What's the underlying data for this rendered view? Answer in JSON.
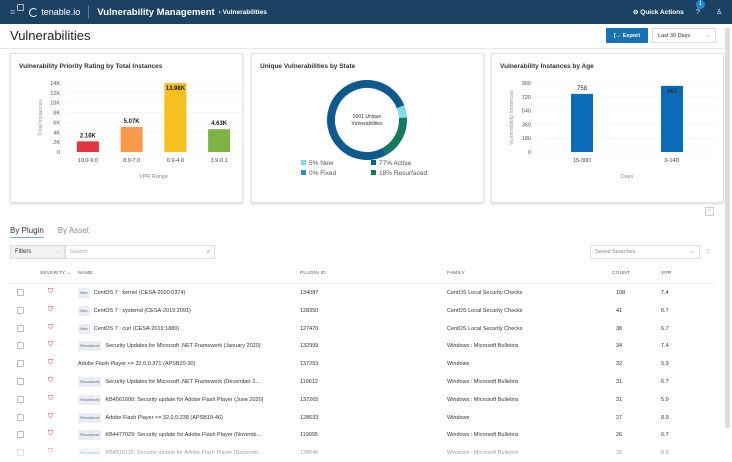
{
  "header": {
    "app_logo": "tenable.io",
    "app": "Vulnerability Management",
    "breadcrumb": "› Vulnerabilities",
    "quick_actions": "Quick Actions",
    "notification_count": "1"
  },
  "page": {
    "title": "Vulnerabilities",
    "export_label": "Export",
    "date_range": "Last 30 Days"
  },
  "colors": {
    "header": "#1b4262",
    "accent": "#1771b8"
  },
  "chart_data": [
    {
      "type": "bar",
      "title": "Vulnerability Priority Rating by Total Instances",
      "xlabel": "VPR Range",
      "ylabel": "Total Instances",
      "ylim": [
        0,
        14000
      ],
      "yticks": [
        "0",
        "2K",
        "4K",
        "6K",
        "8K",
        "10K",
        "12K",
        "14K"
      ],
      "categories": [
        "10.0-9.0",
        "8.9-7.0",
        "6.9-4.0",
        "3.9-0.1"
      ],
      "values": [
        2160,
        5070,
        13980,
        4630
      ],
      "labels": [
        "2.16K",
        "5.07K",
        "13.98K",
        "4.63K"
      ],
      "colors": [
        "#e5333f",
        "#f99a4b",
        "#f6c120",
        "#7cb342"
      ]
    },
    {
      "type": "pie",
      "title": "Unique Vulnerabilities by State",
      "center_text": "5001 Unique Vulnerabilities",
      "slices": [
        {
          "label": "5% New",
          "value": 5,
          "color": "#7ddde8"
        },
        {
          "label": "0% Fixed",
          "value": 0,
          "color": "#2a8ed8"
        },
        {
          "label": "77% Active",
          "value": 77,
          "color": "#0c5a8e"
        },
        {
          "label": "18% Resurfaced",
          "value": 18,
          "color": "#157a5e"
        }
      ]
    },
    {
      "type": "bar",
      "title": "Vulnerability Instances by Age",
      "xlabel": "Days",
      "ylabel": "Vulnerability Instances",
      "ylim": [
        0,
        900
      ],
      "yticks": [
        "0",
        "180",
        "360",
        "540",
        "720",
        "900"
      ],
      "categories": [
        "15-30D",
        "0-14D"
      ],
      "values": [
        758,
        863
      ],
      "labels": [
        "758",
        "863"
      ],
      "colors": [
        "#0a6cb8",
        "#0a6cb8"
      ]
    }
  ],
  "tabs": [
    {
      "label": "By Plugin",
      "active": true
    },
    {
      "label": "By Asset",
      "active": false
    }
  ],
  "filters": {
    "label": "Filters",
    "search_placeholder": "Search",
    "saved_searches": "Saved Searches"
  },
  "table": {
    "columns": [
      "SEVERITY",
      "NAME",
      "PLUGIN ID",
      "FAMILY",
      "COUNT",
      "VPR"
    ],
    "rows": [
      {
        "tag": "New",
        "name": "CentOS 7 : kernel (CESA-2020:0374)",
        "pid": "134087",
        "family": "CentOS Local Security Checks",
        "count": "108",
        "vpr": "7.4"
      },
      {
        "tag": "New",
        "name": "CentOS 7 : systemd (CESA-2019:2091)",
        "pid": "128350",
        "family": "CentOS Local Security Checks",
        "count": "41",
        "vpr": "6.7"
      },
      {
        "tag": "New",
        "name": "CentOS 7 : curl (CESA-2019:1880)",
        "pid": "127470",
        "family": "CentOS Local Security Checks",
        "count": "38",
        "vpr": "6.7"
      },
      {
        "tag": "Resurfaced",
        "name": "Security Updates for Microsoft .NET Framework (January 2020)",
        "pid": "132999",
        "family": "Windows : Microsoft Bulletins",
        "count": "34",
        "vpr": "7.4"
      },
      {
        "tag": "",
        "name": "Adobe Flash Player <= 32.0.0.371 (APSB20-30)",
        "pid": "137253",
        "family": "Windows",
        "count": "32",
        "vpr": "5.9"
      },
      {
        "tag": "Resurfaced",
        "name": "Security Updates for Microsoft .NET Framework (December 2...",
        "pid": "119612",
        "family": "Windows : Microsoft Bulletins",
        "count": "31",
        "vpr": "6.7"
      },
      {
        "tag": "Resurfaced",
        "name": "KB4561600: Security update for Adobe Flash Player (June 2020)",
        "pid": "137265",
        "family": "Windows : Microsoft Bulletins",
        "count": "31",
        "vpr": "5.9"
      },
      {
        "tag": "Resurfaced",
        "name": "Adobe Flash Player <= 32.0.0.238 (APSB19-46)",
        "pid": "128633",
        "family": "Windows",
        "count": "27",
        "vpr": "8.9"
      },
      {
        "tag": "Resurfaced",
        "name": "KB4477029: Security update for Adobe Flash Player (Novemb...",
        "pid": "119095",
        "family": "Windows : Microsoft Bulletins",
        "count": "26",
        "vpr": "6.7"
      },
      {
        "tag": "Resurfaced",
        "name": "KB4516115: Security update for Adobe Flash Player (Septemb...",
        "pid": "128646",
        "family": "Windows : Microsoft Bulletins",
        "count": "26",
        "vpr": "8.9"
      }
    ]
  }
}
